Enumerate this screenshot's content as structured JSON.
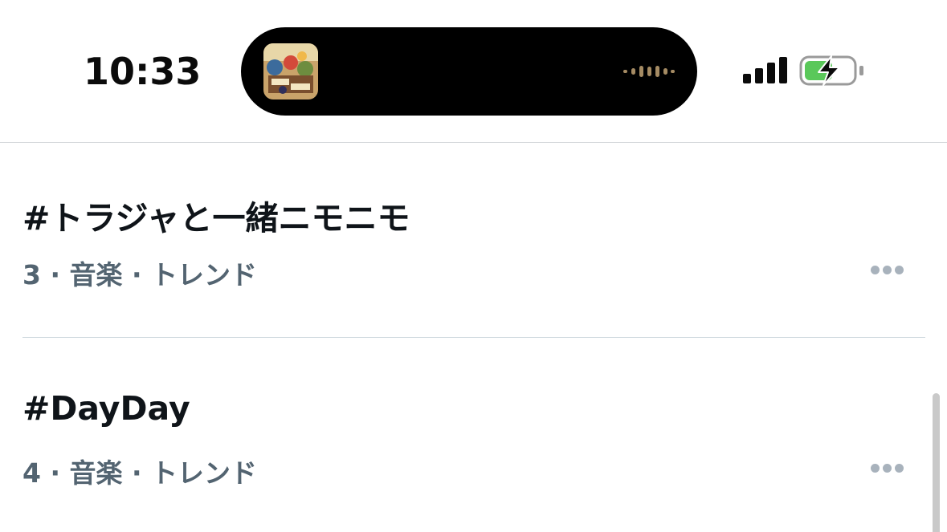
{
  "status_bar": {
    "time": "10:33",
    "icons": [
      "now-playing-album-art",
      "audio-waveform-icon",
      "cellular-signal-icon",
      "battery-charging-icon"
    ],
    "colors": {
      "battery_fill": "#5ac85a",
      "waveform": "#a58b63"
    }
  },
  "trends": [
    {
      "title": "#トラジャと一緒ニモニモ",
      "meta": "3 · 音楽 · トレンド"
    },
    {
      "title": "#DayDay",
      "meta": "4 · 音楽 · トレンド"
    }
  ],
  "colors": {
    "title_text": "#0f1419",
    "meta_text": "#536471",
    "divider": "#cfd9de"
  }
}
